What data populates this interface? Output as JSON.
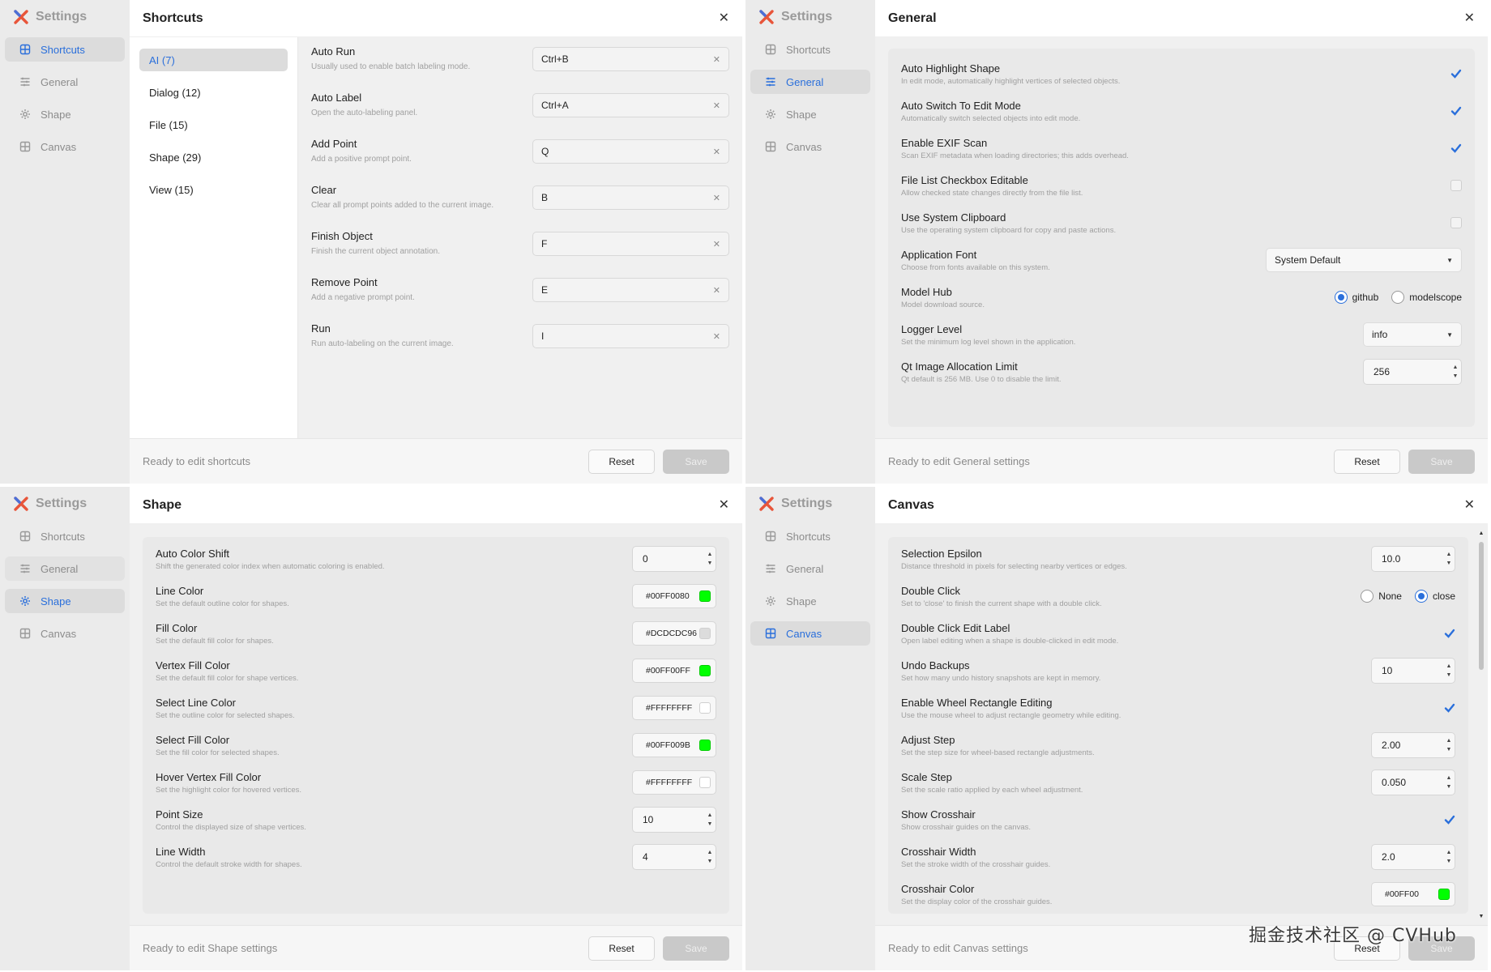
{
  "app_title": "Settings",
  "nav": [
    "Shortcuts",
    "General",
    "Shape",
    "Canvas"
  ],
  "footer": {
    "reset": "Reset",
    "save": "Save"
  },
  "colors": {
    "accent": "#2a6fdb",
    "sidebar_bg": "#ebebeb",
    "panel_bg": "#e9e9e9"
  },
  "shortcuts": {
    "title": "Shortcuts",
    "status": "Ready to edit shortcuts",
    "categories": [
      "AI (7)",
      "Dialog (12)",
      "File (15)",
      "Shape (29)",
      "View (15)"
    ],
    "items": [
      {
        "title": "Auto Run",
        "desc": "Usually used to enable batch labeling mode.",
        "key": "Ctrl+B"
      },
      {
        "title": "Auto Label",
        "desc": "Open the auto-labeling panel.",
        "key": "Ctrl+A"
      },
      {
        "title": "Add Point",
        "desc": "Add a positive prompt point.",
        "key": "Q"
      },
      {
        "title": "Clear",
        "desc": "Clear all prompt points added to the current image.",
        "key": "B"
      },
      {
        "title": "Finish Object",
        "desc": "Finish the current object annotation.",
        "key": "F"
      },
      {
        "title": "Remove Point",
        "desc": "Add a negative prompt point.",
        "key": "E"
      },
      {
        "title": "Run",
        "desc": "Run auto-labeling on the current image.",
        "key": "I"
      }
    ]
  },
  "general": {
    "title": "General",
    "status": "Ready to edit General settings",
    "items": [
      {
        "title": "Auto Highlight Shape",
        "desc": "In edit mode, automatically highlight vertices of selected objects."
      },
      {
        "title": "Auto Switch To Edit Mode",
        "desc": "Automatically switch selected objects into edit mode."
      },
      {
        "title": "Enable EXIF Scan",
        "desc": "Scan EXIF metadata when loading directories; this adds overhead."
      },
      {
        "title": "File List Checkbox Editable",
        "desc": "Allow checked state changes directly from the file list."
      },
      {
        "title": "Use System Clipboard",
        "desc": "Use the operating system clipboard for copy and paste actions."
      },
      {
        "title": "Application Font",
        "desc": "Choose from fonts available on this system.",
        "value": "System Default"
      },
      {
        "title": "Model Hub",
        "desc": "Model download source.",
        "options": [
          "github",
          "modelscope"
        ]
      },
      {
        "title": "Logger Level",
        "desc": "Set the minimum log level shown in the application.",
        "value": "info"
      },
      {
        "title": "Qt Image Allocation Limit",
        "desc": "Qt default is 256 MB. Use 0 to disable the limit.",
        "value": "256"
      }
    ]
  },
  "shape": {
    "title": "Shape",
    "status": "Ready to edit Shape settings",
    "items": [
      {
        "title": "Auto Color Shift",
        "desc": "Shift the generated color index when automatic coloring is enabled.",
        "value": "0"
      },
      {
        "title": "Line Color",
        "desc": "Set the default outline color for shapes.",
        "value": "#00FF0080",
        "swatch": "#00ff00"
      },
      {
        "title": "Fill Color",
        "desc": "Set the default fill color for shapes.",
        "value": "#DCDCDC96",
        "swatch": "#dcdcdc"
      },
      {
        "title": "Vertex Fill Color",
        "desc": "Set the default fill color for shape vertices.",
        "value": "#00FF00FF",
        "swatch": "#00ff00"
      },
      {
        "title": "Select Line Color",
        "desc": "Set the outline color for selected shapes.",
        "value": "#FFFFFFFF",
        "swatch": "#ffffff"
      },
      {
        "title": "Select Fill Color",
        "desc": "Set the fill color for selected shapes.",
        "value": "#00FF009B",
        "swatch": "#00ff00"
      },
      {
        "title": "Hover Vertex Fill Color",
        "desc": "Set the highlight color for hovered vertices.",
        "value": "#FFFFFFFF",
        "swatch": "#ffffff"
      },
      {
        "title": "Point Size",
        "desc": "Control the displayed size of shape vertices.",
        "value": "10"
      },
      {
        "title": "Line Width",
        "desc": "Control the default stroke width for shapes.",
        "value": "4"
      }
    ]
  },
  "canvas": {
    "title": "Canvas",
    "status": "Ready to edit Canvas settings",
    "items": [
      {
        "title": "Selection Epsilon",
        "desc": "Distance threshold in pixels for selecting nearby vertices or edges.",
        "value": "10.0"
      },
      {
        "title": "Double Click",
        "desc": "Set to 'close' to finish the current shape with a double click.",
        "options": [
          "None",
          "close"
        ]
      },
      {
        "title": "Double Click Edit Label",
        "desc": "Open label editing when a shape is double-clicked in edit mode."
      },
      {
        "title": "Undo Backups",
        "desc": "Set how many undo history snapshots are kept in memory.",
        "value": "10"
      },
      {
        "title": "Enable Wheel Rectangle Editing",
        "desc": "Use the mouse wheel to adjust rectangle geometry while editing."
      },
      {
        "title": "Adjust Step",
        "desc": "Set the step size for wheel-based rectangle adjustments.",
        "value": "2.00"
      },
      {
        "title": "Scale Step",
        "desc": "Set the scale ratio applied by each wheel adjustment.",
        "value": "0.050"
      },
      {
        "title": "Show Crosshair",
        "desc": "Show crosshair guides on the canvas."
      },
      {
        "title": "Crosshair Width",
        "desc": "Set the stroke width of the crosshair guides.",
        "value": "2.0"
      },
      {
        "title": "Crosshair Color",
        "desc": "Set the display color of the crosshair guides.",
        "value": "#00FF00",
        "swatch": "#00ff00"
      }
    ]
  },
  "watermark": "掘金技术社区 @ CVHub"
}
